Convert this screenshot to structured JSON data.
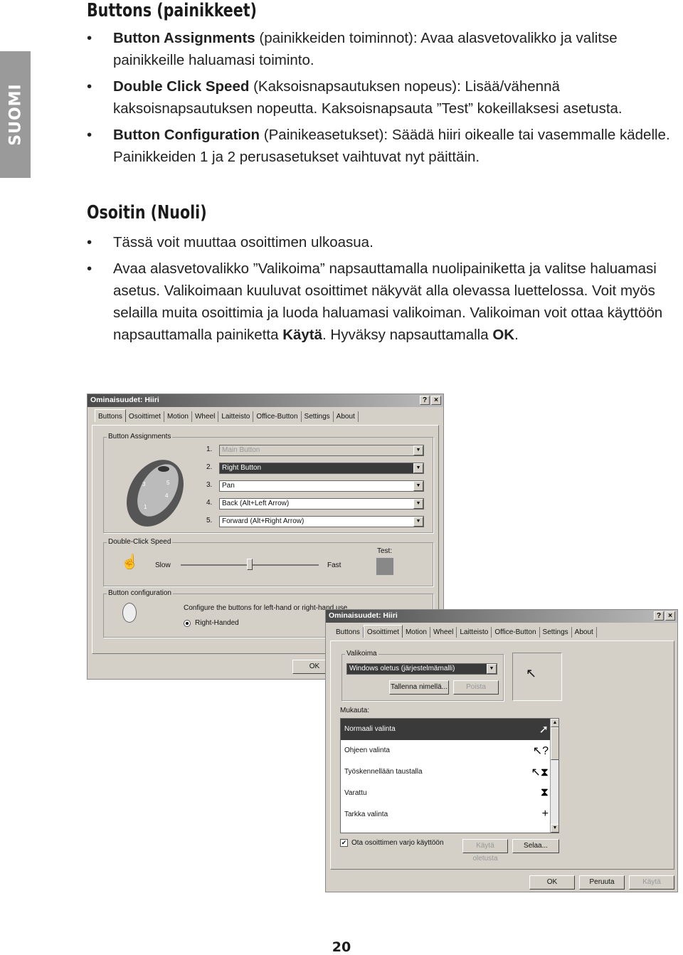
{
  "side_tab": "SUOMI",
  "section1": {
    "title": "Buttons (painikkeet)",
    "bullets": [
      {
        "bold": "Button Assignments",
        "text": " (painikkeiden toiminnot): Avaa alasvetovalikko ja valitse painikkeille haluamasi toiminto."
      },
      {
        "bold": "Double Click Speed",
        "text": " (Kaksoisnapsautuksen nopeus): Lisää/vähennä kaksoisnapsautuksen nopeutta. Kaksoisnapsauta ”Test” kokeillaksesi asetusta."
      },
      {
        "bold": "Button Configuration",
        "text": " (Painikeasetukset): Säädä hiiri oikealle tai vasemmalle kädelle. Painikkeiden 1 ja 2 perusasetukset vaihtuvat nyt päittäin."
      }
    ]
  },
  "section2": {
    "title": "Osoitin (Nuoli)",
    "bullet1": "Tässä voit muuttaa osoittimen ulkoasua.",
    "bullet2_a": "Avaa alasvetovalikko ”Valikoima” napsauttamalla nuolipainiketta ja valitse haluamasi asetus. Valikoimaan kuuluvat osoittimet näkyvät alla olevassa luettelossa. Voit myös selailla muita osoittimia ja luoda haluamasi valikoiman. Valikoiman voit ottaa käyttöön napsauttamalla painiketta ",
    "bullet2_b1": "Käytä",
    "bullet2_c": ". Hyväksy napsauttamalla ",
    "bullet2_b2": "OK",
    "bullet2_d": "."
  },
  "dialog1": {
    "title": "Ominaisuudet: Hiiri",
    "help": "?",
    "close": "×",
    "tabs": [
      "Buttons",
      "Osoittimet",
      "Motion",
      "Wheel",
      "Laitteisto",
      "Office-Button",
      "Settings",
      "About"
    ],
    "active_tab": "Buttons",
    "assign_group": "Button Assignments",
    "assignments": [
      {
        "num": "1.",
        "value": "Main Button",
        "state": "disabled"
      },
      {
        "num": "2.",
        "value": "Right Button",
        "state": "selected"
      },
      {
        "num": "3.",
        "value": "Pan",
        "state": "normal"
      },
      {
        "num": "4.",
        "value": "Back (Alt+Left Arrow)",
        "state": "normal"
      },
      {
        "num": "5.",
        "value": "Forward (Alt+Right Arrow)",
        "state": "normal"
      }
    ],
    "speed_group": "Double-Click Speed",
    "slow": "Slow",
    "fast": "Fast",
    "test": "Test:",
    "speed_value_fraction": 0.5,
    "config_group": "Button configuration",
    "config_text": "Configure the buttons for left-hand or right-hand use.",
    "right_handed": "Right-Handed",
    "ok": "OK"
  },
  "dialog2": {
    "title": "Ominaisuudet: Hiiri",
    "help": "?",
    "close": "×",
    "tabs": [
      "Buttons",
      "Osoittimet",
      "Motion",
      "Wheel",
      "Laitteisto",
      "Office-Button",
      "Settings",
      "About"
    ],
    "active_tab": "Osoittimet",
    "scheme_group": "Valikoima",
    "scheme_value": "Windows oletus (järjestelmämalli)",
    "save_as": "Tallenna nimellä...",
    "delete": "Poista",
    "customize": "Mukauta:",
    "cursors": [
      {
        "label": "Normaali valinta",
        "icon": "arrow-cursor",
        "glyph": "➚"
      },
      {
        "label": "Ohjeen valinta",
        "icon": "help-cursor",
        "glyph": "↖?"
      },
      {
        "label": "Työskennellään taustalla",
        "icon": "working-cursor",
        "glyph": "↖⧗"
      },
      {
        "label": "Varattu",
        "icon": "busy-cursor",
        "glyph": "⧗"
      },
      {
        "label": "Tarkka valinta",
        "icon": "crosshair-cursor",
        "glyph": "+"
      }
    ],
    "shadow_label": "Ota osoittimen varjo käyttöön",
    "shadow_checked": true,
    "use_default": "Käytä oletusta",
    "browse": "Selaa...",
    "ok": "OK",
    "cancel": "Peruuta",
    "apply": "Käytä"
  },
  "page_number": "20"
}
